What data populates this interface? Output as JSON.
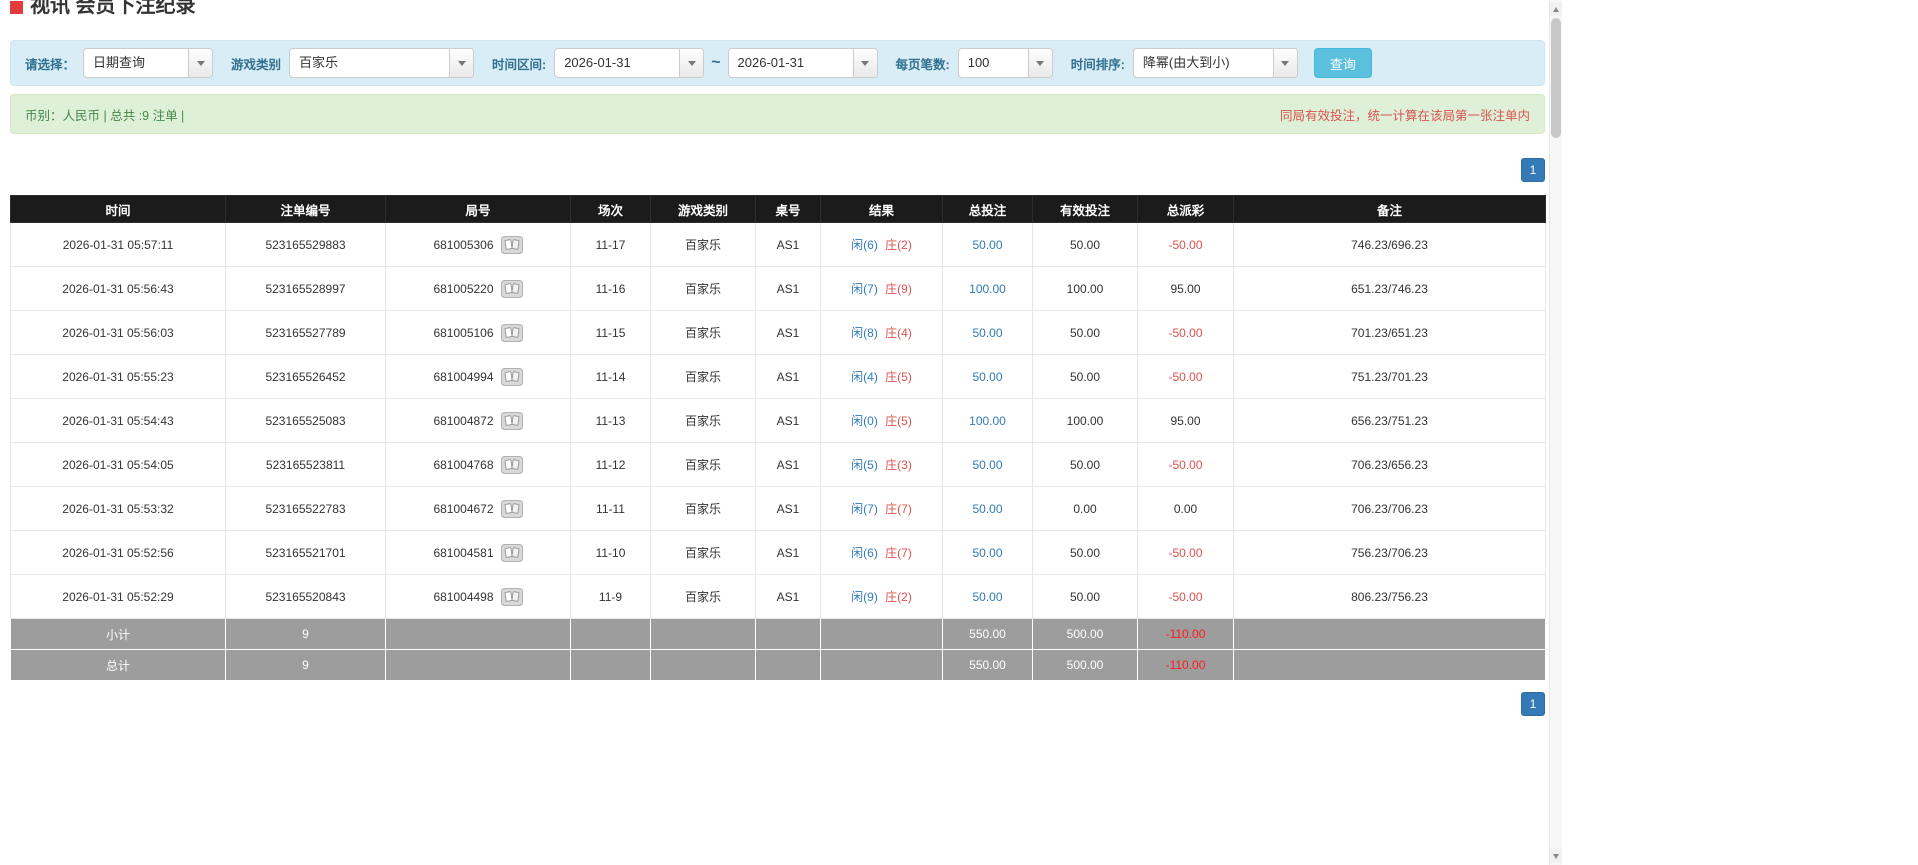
{
  "page": {
    "title": "视讯 会员下注纪录"
  },
  "colors": {
    "accent_blue": "#337ab7",
    "search_button_blue": "#5bc0de",
    "negative_red": "#d9534f",
    "player_blue": "#337ab7",
    "banker_red": "#d9534f",
    "header_bg": "#1b1b1b",
    "footer_bg": "#9d9d9d",
    "filter_bar_bg": "#d9edf7",
    "summary_bar_bg": "#dff0d8"
  },
  "filters": {
    "select_label": "请选择：",
    "select_value": "日期查询",
    "game_label": "游戏类别",
    "game_value": "百家乐",
    "range_label": "时间区间:",
    "date_from": "2026-01-31",
    "tilde": "~",
    "date_to": "2026-01-31",
    "page_size_label": "每页笔数:",
    "page_size_value": "100",
    "sort_label": "时间排序:",
    "sort_value": "降幂(由大到小)",
    "search_button": "查询"
  },
  "summary": {
    "left": "币别：人民币 | 总共 :9 注单 |",
    "right": "同局有效投注，统一计算在该局第一张注单内"
  },
  "pagination": {
    "page": "1"
  },
  "table": {
    "headers": [
      "时间",
      "注单编号",
      "局号",
      "场次",
      "游戏类别",
      "桌号",
      "结果",
      "总投注",
      "有效投注",
      "总派彩",
      "备注"
    ],
    "rows": [
      {
        "time": "2026-01-31 05:57:11",
        "bet_id": "523165529883",
        "round_id": "681005306",
        "session": "11-17",
        "game": "百家乐",
        "table_no": "AS1",
        "result_player": "闲(6)",
        "result_banker": "庄(2)",
        "total_bet": "50.00",
        "valid_bet": "50.00",
        "payout": "-50.00",
        "remark": "746.23/696.23"
      },
      {
        "time": "2026-01-31 05:56:43",
        "bet_id": "523165528997",
        "round_id": "681005220",
        "session": "11-16",
        "game": "百家乐",
        "table_no": "AS1",
        "result_player": "闲(7)",
        "result_banker": "庄(9)",
        "total_bet": "100.00",
        "valid_bet": "100.00",
        "payout": "95.00",
        "remark": "651.23/746.23"
      },
      {
        "time": "2026-01-31 05:56:03",
        "bet_id": "523165527789",
        "round_id": "681005106",
        "session": "11-15",
        "game": "百家乐",
        "table_no": "AS1",
        "result_player": "闲(8)",
        "result_banker": "庄(4)",
        "total_bet": "50.00",
        "valid_bet": "50.00",
        "payout": "-50.00",
        "remark": "701.23/651.23"
      },
      {
        "time": "2026-01-31 05:55:23",
        "bet_id": "523165526452",
        "round_id": "681004994",
        "session": "11-14",
        "game": "百家乐",
        "table_no": "AS1",
        "result_player": "闲(4)",
        "result_banker": "庄(5)",
        "total_bet": "50.00",
        "valid_bet": "50.00",
        "payout": "-50.00",
        "remark": "751.23/701.23"
      },
      {
        "time": "2026-01-31 05:54:43",
        "bet_id": "523165525083",
        "round_id": "681004872",
        "session": "11-13",
        "game": "百家乐",
        "table_no": "AS1",
        "result_player": "闲(0)",
        "result_banker": "庄(5)",
        "total_bet": "100.00",
        "valid_bet": "100.00",
        "payout": "95.00",
        "remark": "656.23/751.23"
      },
      {
        "time": "2026-01-31 05:54:05",
        "bet_id": "523165523811",
        "round_id": "681004768",
        "session": "11-12",
        "game": "百家乐",
        "table_no": "AS1",
        "result_player": "闲(5)",
        "result_banker": "庄(3)",
        "total_bet": "50.00",
        "valid_bet": "50.00",
        "payout": "-50.00",
        "remark": "706.23/656.23"
      },
      {
        "time": "2026-01-31 05:53:32",
        "bet_id": "523165522783",
        "round_id": "681004672",
        "session": "11-11",
        "game": "百家乐",
        "table_no": "AS1",
        "result_player": "闲(7)",
        "result_banker": "庄(7)",
        "total_bet": "50.00",
        "valid_bet": "0.00",
        "payout": "0.00",
        "remark": "706.23/706.23"
      },
      {
        "time": "2026-01-31 05:52:56",
        "bet_id": "523165521701",
        "round_id": "681004581",
        "session": "11-10",
        "game": "百家乐",
        "table_no": "AS1",
        "result_player": "闲(6)",
        "result_banker": "庄(7)",
        "total_bet": "50.00",
        "valid_bet": "50.00",
        "payout": "-50.00",
        "remark": "756.23/706.23"
      },
      {
        "time": "2026-01-31 05:52:29",
        "bet_id": "523165520843",
        "round_id": "681004498",
        "session": "11-9",
        "game": "百家乐",
        "table_no": "AS1",
        "result_player": "闲(9)",
        "result_banker": "庄(2)",
        "total_bet": "50.00",
        "valid_bet": "50.00",
        "payout": "-50.00",
        "remark": "806.23/756.23"
      }
    ],
    "subtotal": {
      "label": "小计",
      "count": "9",
      "total_bet": "550.00",
      "valid_bet": "500.00",
      "payout": "-110.00"
    },
    "total": {
      "label": "总计",
      "count": "9",
      "total_bet": "550.00",
      "valid_bet": "500.00",
      "payout": "-110.00"
    }
  }
}
